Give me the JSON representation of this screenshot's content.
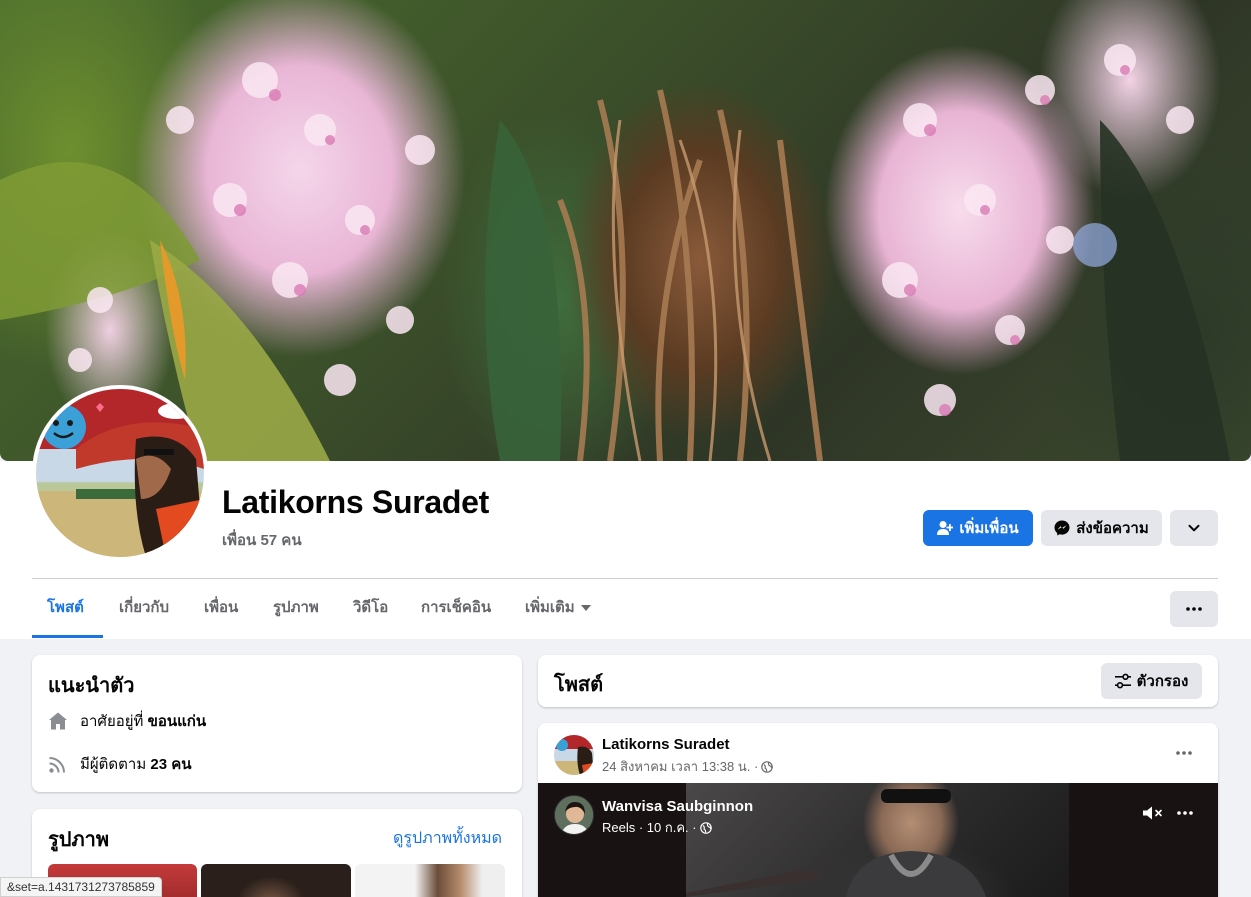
{
  "profile": {
    "name": "Latikorns Suradet",
    "friends_count": "เพื่อน 57 คน"
  },
  "actions": {
    "add_friend": "เพิ่มเพื่อน",
    "message": "ส่งข้อความ"
  },
  "tabs": [
    {
      "label": "โพสต์",
      "active": true
    },
    {
      "label": "เกี่ยวกับ"
    },
    {
      "label": "เพื่อน"
    },
    {
      "label": "รูปภาพ"
    },
    {
      "label": "วิดีโอ"
    },
    {
      "label": "การเช็คอิน"
    },
    {
      "label": "เพิ่มเติม"
    }
  ],
  "intro": {
    "title": "แนะนำตัว",
    "lives_prefix": "อาศัยอยู่ที่ ",
    "lives_place": "ขอนแก่น",
    "followers_prefix": "มีผู้ติดตาม ",
    "followers_count": "23 คน"
  },
  "photos": {
    "title": "รูปภาพ",
    "see_all": "ดูรูปภาพทั้งหมด"
  },
  "posts": {
    "title": "โพสต์",
    "filter_label": "ตัวกรอง",
    "first": {
      "author": "Latikorns Suradet",
      "meta": "24 สิงหาคม เวลา 13:38 น. ·",
      "shared_author": "Wanvisa Saubginnon",
      "shared_meta": "Reels · 10 ก.ค. ·"
    }
  },
  "status_bar": {
    "url": "&set=a.1431731273785859"
  },
  "colors": {
    "accent": "#1b74e4",
    "background": "#f0f2f5",
    "secondary_button": "#e4e6eb"
  }
}
